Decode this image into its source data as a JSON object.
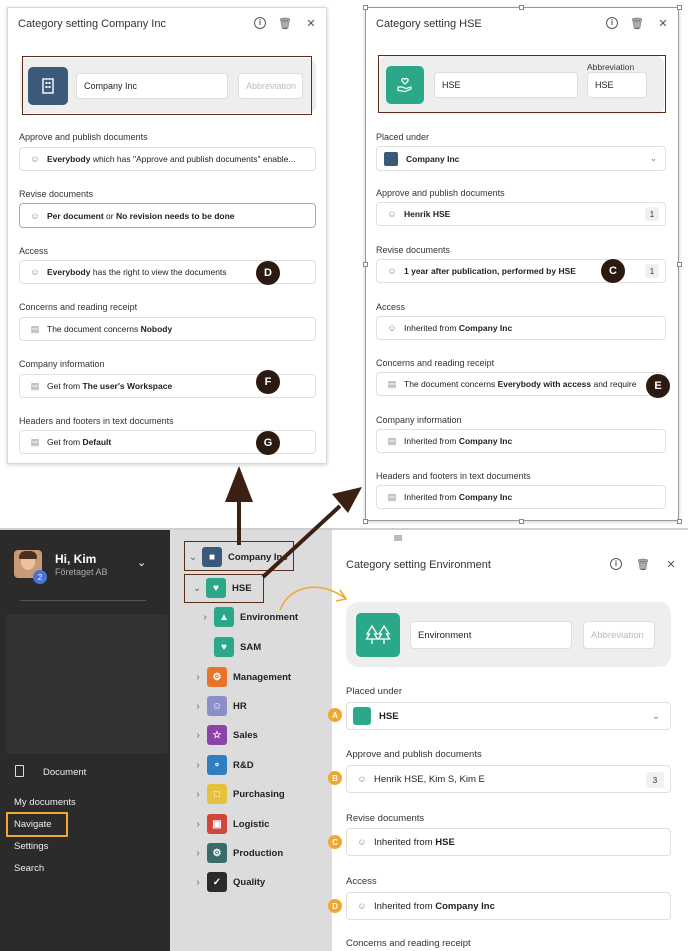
{
  "company_panel": {
    "title": "Category setting Company Inc",
    "name_value": "Company Inc",
    "abbreviation_placeholder": "Abbreviation",
    "sections": [
      {
        "label": "Approve and publish documents",
        "pre": "",
        "bold": "Everybody",
        "post": " which has \"Approve and publish documents\" enable..."
      },
      {
        "label": "Revise documents",
        "pre": "",
        "bold": "Per document",
        "post": " or ",
        "bold2": "No revision needs to be done"
      },
      {
        "label": "Access",
        "pre": "",
        "bold": "Everybody",
        "post": " has the right to view the documents"
      },
      {
        "label": "Concerns and reading receipt",
        "pre": "The document concerns ",
        "bold": "Nobody",
        "post": ""
      },
      {
        "label": "Company information",
        "pre": "Get from ",
        "bold": "The user's Workspace",
        "post": ""
      },
      {
        "label": "Headers and footers in text documents",
        "pre": "Get from ",
        "bold": "Default",
        "post": ""
      }
    ]
  },
  "hse_panel": {
    "title": "Category setting HSE",
    "name_value": "HSE",
    "abbreviation_label": "Abbreviation",
    "abbreviation_value": "HSE",
    "sections": [
      {
        "label": "Placed under",
        "pre": "",
        "bold": "Company Inc",
        "post": ""
      },
      {
        "label": "Approve and publish documents",
        "pre": "",
        "bold": "Henrik HSE",
        "post": "",
        "count": "1"
      },
      {
        "label": "Revise documents",
        "pre": "",
        "bold": "1 year after publication, performed by HSE",
        "post": "",
        "count": "1"
      },
      {
        "label": "Access",
        "pre": "Inherited from ",
        "bold": "Company Inc",
        "post": ""
      },
      {
        "label": "Concerns and reading receipt",
        "pre": "The document concerns ",
        "bold": "Everybody with access",
        "post": " and require"
      },
      {
        "label": "Company information",
        "pre": "Inherited from ",
        "bold": "Company Inc",
        "post": ""
      },
      {
        "label": "Headers and footers in text documents",
        "pre": "Inherited from ",
        "bold": "Company Inc",
        "post": ""
      }
    ]
  },
  "markers": {
    "a": "A",
    "b": "B",
    "c": "C",
    "d": "D",
    "e": "E",
    "f": "F",
    "g": "G"
  },
  "user": {
    "greeting": "Hi, Kim",
    "company": "Företaget AB",
    "badge": "2"
  },
  "nav": {
    "document": "Document",
    "items": [
      "My documents",
      "Navigate",
      "Settings",
      "Search"
    ]
  },
  "tree": [
    {
      "label": "Company Inc",
      "color": "#3b5a7a"
    },
    {
      "label": "HSE",
      "color": "#2aa889"
    },
    {
      "label": "Environment",
      "color": "#2aa889"
    },
    {
      "label": "SAM",
      "color": "#2aa889"
    },
    {
      "label": "Management",
      "color": "#e8742a"
    },
    {
      "label": "HR",
      "color": "#8a8fc8"
    },
    {
      "label": "Sales",
      "color": "#8b44a8"
    },
    {
      "label": "R&D",
      "color": "#2f7fc0"
    },
    {
      "label": "Purchasing",
      "color": "#e6c13a"
    },
    {
      "label": "Logistic",
      "color": "#d0463a"
    },
    {
      "label": "Production",
      "color": "#3a6a6a"
    },
    {
      "label": "Quality",
      "color": "#2b2b2b"
    }
  ],
  "env_panel": {
    "title": "Category setting Environment",
    "name_value": "Environment",
    "abbreviation_placeholder": "Abbreviation",
    "sections": [
      {
        "label": "Placed under",
        "pre": "",
        "bold": "HSE",
        "post": ""
      },
      {
        "label": "Approve and publish documents",
        "pre": "",
        "bold": "Henrik HSE, Kim S, Kim E",
        "post": "",
        "count": "3"
      },
      {
        "label": "Revise documents",
        "pre": "Inherited from ",
        "bold": "HSE",
        "post": ""
      },
      {
        "label": "Access",
        "pre": "Inherited from ",
        "bold": "Company Inc",
        "post": ""
      },
      {
        "label": "Concerns and reading receipt"
      }
    ]
  },
  "colors": {
    "accent_orange": "#f0a830",
    "marker_brown": "#2b1a10",
    "outline_brown": "#5a2d1a",
    "teal": "#2aa889"
  }
}
